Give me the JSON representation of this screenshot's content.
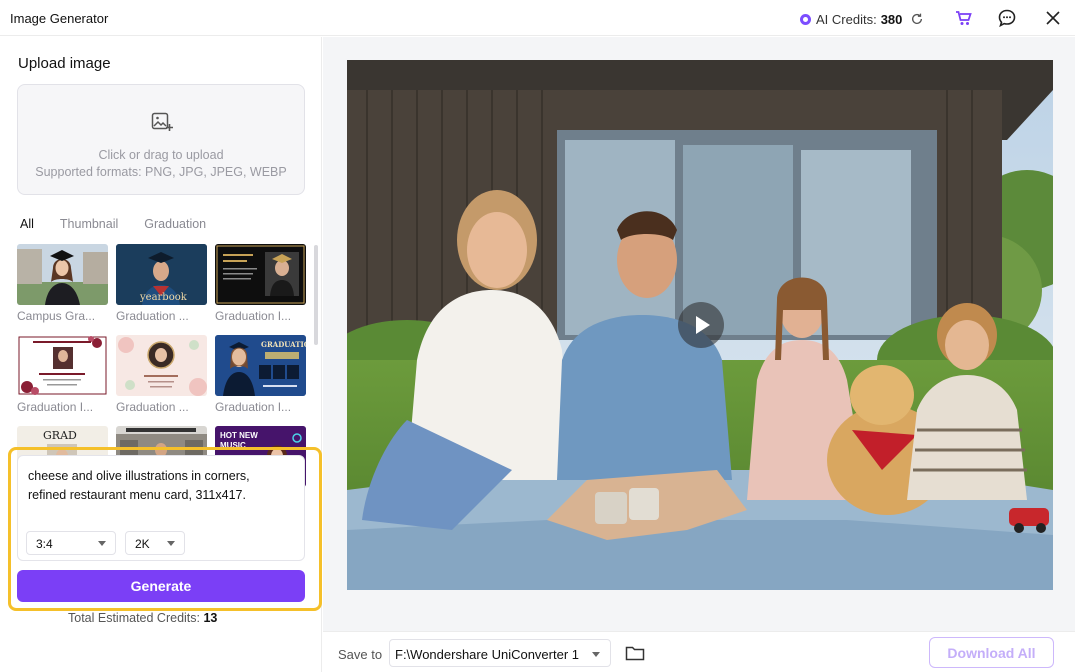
{
  "window": {
    "title": "Image Generator",
    "credits_label": "AI Credits:",
    "credits_value": "380"
  },
  "upload": {
    "title": "Upload image",
    "hint_line1": "Click or drag to upload",
    "hint_line2": "Supported formats: PNG, JPG, JPEG, WEBP"
  },
  "tabs": [
    {
      "label": "All",
      "active": true
    },
    {
      "label": "Thumbnail",
      "active": false
    },
    {
      "label": "Graduation",
      "active": false
    }
  ],
  "templates": [
    {
      "label": "Campus Gra...",
      "thumb_text": ""
    },
    {
      "label": "Graduation ...",
      "thumb_text": "yearbook"
    },
    {
      "label": "Graduation I...",
      "thumb_text": ""
    },
    {
      "label": "Graduation I...",
      "thumb_text": ""
    },
    {
      "label": "Graduation ...",
      "thumb_text": ""
    },
    {
      "label": "Graduation I...",
      "thumb_text": "GRADUATION"
    },
    {
      "label": "",
      "thumb_text": "GRAD"
    },
    {
      "label": "",
      "thumb_text": ""
    },
    {
      "label": "",
      "thumb_text": "HOT NEW MUSIC"
    }
  ],
  "prompt": {
    "text": "cheese and olive illustrations in corners, refined restaurant menu card, 311x417.",
    "ratio": "3:4",
    "resolution": "2K"
  },
  "generate_label": "Generate",
  "estimate": {
    "label": "Total Estimated Credits:",
    "value": "13"
  },
  "save": {
    "label": "Save to",
    "path": "F:\\Wondershare UniConverter 1"
  },
  "download_label": "Download All",
  "colors": {
    "accent": "#7b3ff6",
    "highlight": "#f5c02a"
  }
}
